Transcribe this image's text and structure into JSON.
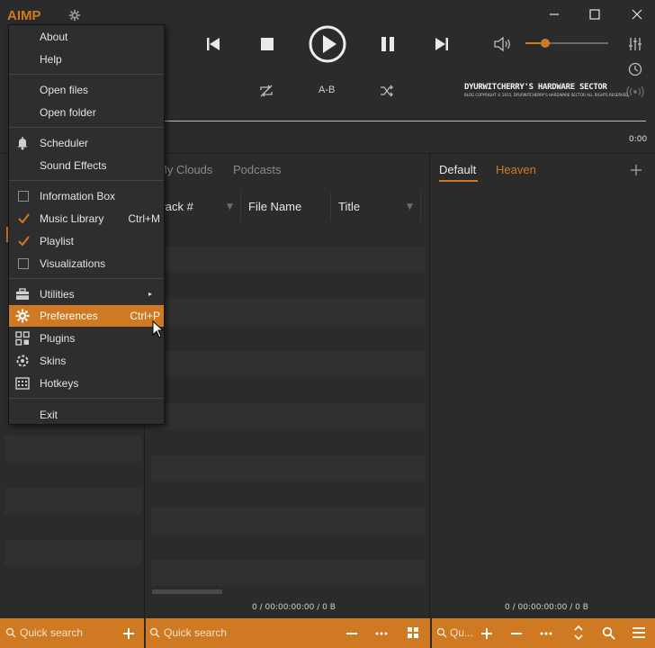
{
  "app": {
    "logo": "AIMP"
  },
  "player": {
    "ab_label": "A-B",
    "time_elapsed": "0:00"
  },
  "banner": {
    "title": "DYURWITCHERRY'S HARDWARE SECTOR",
    "subtitle": "BLOG COPYRIGHT © 2015, DYURWITCHERRY'S HARDWARE SECTOR ALL RIGHTS RESERVED."
  },
  "library": {
    "tabs": [
      "My Clouds",
      "Podcasts"
    ],
    "columns": [
      "Track #",
      "File Name",
      "Title"
    ],
    "status": "0 / 00:00:00:00 / 0 B"
  },
  "playlist": {
    "tabs": [
      "Default",
      "Heaven"
    ],
    "status": "0 / 00:00:00:00 / 0 B"
  },
  "bottom": {
    "qs_left": "Quick search",
    "qs_mid": "Quick search",
    "qs_right": "Qu..."
  },
  "menu": {
    "about": "About",
    "help": "Help",
    "open_files": "Open files",
    "open_folder": "Open folder",
    "scheduler": "Scheduler",
    "sound_effects": "Sound Effects",
    "information_box": "Information Box",
    "music_library": "Music Library",
    "music_library_sc": "Ctrl+M",
    "playlist": "Playlist",
    "visualizations": "Visualizations",
    "utilities": "Utilities",
    "preferences": "Preferences",
    "preferences_sc": "Ctrl+P",
    "plugins": "Plugins",
    "skins": "Skins",
    "hotkeys": "Hotkeys",
    "exit": "Exit"
  },
  "colors": {
    "accent": "#cf7a22",
    "background": "#2b2b2b",
    "menu_bg": "#2e2e2e"
  }
}
